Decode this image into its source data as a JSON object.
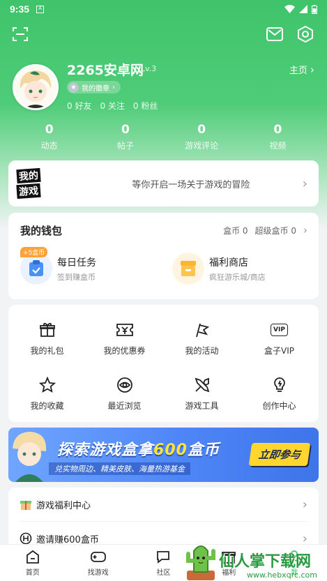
{
  "status": {
    "time": "9:35"
  },
  "profile": {
    "name": "2265安卓网",
    "level": "Lv.3",
    "homepage": "主页",
    "badge": "我的徽章",
    "friends": "0 好友",
    "following": "0 关注",
    "fans": "0 粉丝"
  },
  "stats": [
    {
      "value": "0",
      "label": "动态"
    },
    {
      "value": "0",
      "label": "帖子"
    },
    {
      "value": "0",
      "label": "游戏评论"
    },
    {
      "value": "0",
      "label": "视频"
    }
  ],
  "my_games": {
    "logo_line1": "我的",
    "logo_line2": "游戏",
    "text": "等你开启一场关于游戏的冒险"
  },
  "wallet": {
    "title": "我的钱包",
    "coins": "盒币 0",
    "super_coins": "超级盒币 0",
    "tiles": [
      {
        "tag": "+5盒币",
        "title": "每日任务",
        "subtitle": "签到赚盒币",
        "icon": "clipboard-check-icon",
        "color": "#4a90f5"
      },
      {
        "title": "福利商店",
        "subtitle": "疯狂游乐城/商店",
        "icon": "shop-icon",
        "color": "#ffb52e"
      }
    ]
  },
  "grid": [
    {
      "label": "我的礼包",
      "icon": "gift-icon"
    },
    {
      "label": "我的优惠券",
      "icon": "coupon-icon"
    },
    {
      "label": "我的活动",
      "icon": "flag-icon"
    },
    {
      "label": "盒子VIP",
      "icon": "vip-icon",
      "icon_text": "VIP"
    },
    {
      "label": "我的收藏",
      "icon": "star-icon"
    },
    {
      "label": "最近浏览",
      "icon": "eye-icon"
    },
    {
      "label": "游戏工具",
      "icon": "tools-icon"
    },
    {
      "label": "创作中心",
      "icon": "lightbulb-icon"
    }
  ],
  "banner": {
    "headline_a": "探索游戏盒拿",
    "headline_b": "600",
    "headline_c": "盒币",
    "subtitle": "兑实物周边、精美皮肤、海量热游基金",
    "cta": "立即参与"
  },
  "list": [
    {
      "label": "游戏福利中心",
      "icon": "gift-box-icon"
    },
    {
      "label": "邀请赚600盒币",
      "icon": "h-coin-icon"
    }
  ],
  "tabs": [
    {
      "label": "首页",
      "icon": "home-icon"
    },
    {
      "label": "找游戏",
      "icon": "gamepad-icon"
    },
    {
      "label": "社区",
      "icon": "chat-icon"
    },
    {
      "label": "福利",
      "icon": "gift-tab-icon"
    },
    {
      "label": "我",
      "icon": "user-icon"
    }
  ],
  "watermark": {
    "main": "仙人掌下载网",
    "url": "www.hebxqrc.com"
  }
}
